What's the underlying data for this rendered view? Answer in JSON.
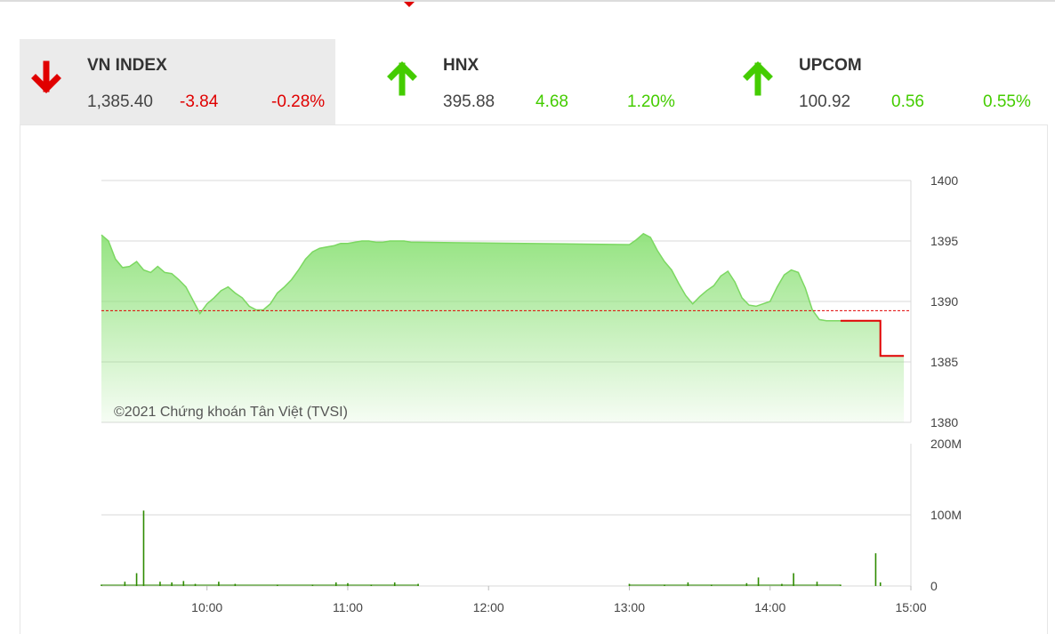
{
  "indices": [
    {
      "name": "VN INDEX",
      "value": "1,385.40",
      "change": "-3.84",
      "percent": "-0.28%",
      "direction": "down",
      "active": true
    },
    {
      "name": "HNX",
      "value": "395.88",
      "change": "4.68",
      "percent": "1.20%",
      "direction": "up",
      "active": false
    },
    {
      "name": "UPCOM",
      "value": "100.92",
      "change": "0.56",
      "percent": "0.55%",
      "direction": "up",
      "active": false
    }
  ],
  "colors": {
    "up": "#44cc00",
    "down": "#e00000",
    "area": "#8fe27a",
    "volume": "#2e8b00",
    "reference": "#e00000"
  },
  "chart_data": [
    {
      "type": "area",
      "title": "",
      "watermark": "©2021 Chứng khoán Tân Việt (TVSI)",
      "y_ticks": [
        "1400",
        "1395",
        "1390",
        "1385",
        "1380"
      ],
      "ylim": [
        1380,
        1400
      ],
      "x_ticks": [
        "10:00",
        "11:00",
        "12:00",
        "13:00",
        "14:00",
        "15:00"
      ],
      "reference": 1389.24,
      "grid": true,
      "series": [
        {
          "x": [
            "09:15",
            "09:18",
            "09:21",
            "09:24",
            "09:27",
            "09:30",
            "09:33",
            "09:36",
            "09:39",
            "09:42",
            "09:45",
            "09:48",
            "09:51",
            "09:54",
            "09:57",
            "10:00",
            "10:03",
            "10:06",
            "10:09",
            "10:12",
            "10:15",
            "10:18",
            "10:21",
            "10:24",
            "10:27",
            "10:30",
            "10:33",
            "10:36",
            "10:39",
            "10:42",
            "10:45",
            "10:48",
            "10:51",
            "10:54",
            "10:57",
            "11:00",
            "11:03",
            "11:06",
            "11:09",
            "11:12",
            "11:15",
            "11:18",
            "11:21",
            "11:24",
            "11:27",
            "11:30",
            "13:00",
            "13:03",
            "13:06",
            "13:09",
            "13:12",
            "13:15",
            "13:18",
            "13:21",
            "13:24",
            "13:27",
            "13:30",
            "13:33",
            "13:36",
            "13:39",
            "13:42",
            "13:45",
            "13:48",
            "13:51",
            "13:54",
            "13:57",
            "14:00",
            "14:03",
            "14:06",
            "14:09",
            "14:12",
            "14:15",
            "14:18",
            "14:21",
            "14:24",
            "14:27",
            "14:30"
          ],
          "y": [
            1395.5,
            1395.0,
            1393.5,
            1392.8,
            1392.9,
            1393.3,
            1392.6,
            1392.4,
            1392.9,
            1392.4,
            1392.3,
            1391.8,
            1391.2,
            1390.1,
            1389.0,
            1389.8,
            1390.3,
            1390.9,
            1391.2,
            1390.7,
            1390.3,
            1389.6,
            1389.3,
            1389.3,
            1389.8,
            1390.7,
            1391.2,
            1391.8,
            1392.6,
            1393.5,
            1394.1,
            1394.4,
            1394.5,
            1394.6,
            1394.8,
            1394.8,
            1394.9,
            1395.0,
            1395.0,
            1394.9,
            1394.9,
            1395.0,
            1395.0,
            1395.0,
            1394.9,
            1394.9,
            1394.7,
            1395.1,
            1395.6,
            1395.3,
            1394.2,
            1393.3,
            1392.6,
            1391.5,
            1390.5,
            1389.8,
            1390.4,
            1390.9,
            1391.3,
            1392.1,
            1392.5,
            1391.6,
            1390.3,
            1389.7,
            1389.6,
            1389.8,
            1390.0,
            1391.2,
            1392.2,
            1392.6,
            1392.4,
            1391.1,
            1389.3,
            1388.5,
            1388.4,
            1388.4,
            1388.4
          ]
        },
        {
          "x": [
            "14:30",
            "14:47",
            "14:47",
            "14:57"
          ],
          "y": [
            1388.4,
            1388.4,
            1385.5,
            1385.5
          ]
        }
      ]
    },
    {
      "type": "bar",
      "title": "",
      "y_ticks": [
        "200M",
        "100M",
        "0"
      ],
      "ylim": [
        0,
        200000000
      ],
      "x_ticks": [
        "10:00",
        "11:00",
        "12:00",
        "13:00",
        "14:00",
        "15:00"
      ],
      "grid": true,
      "series": [
        {
          "x": [
            "09:15",
            "09:25",
            "09:30",
            "09:33",
            "09:40",
            "09:45",
            "09:50",
            "09:55",
            "10:05",
            "10:12",
            "10:30",
            "10:45",
            "10:55",
            "11:00",
            "11:10",
            "11:20",
            "11:30",
            "13:00",
            "13:15",
            "13:25",
            "13:35",
            "13:50",
            "13:55",
            "14:05",
            "14:10",
            "14:20",
            "14:30",
            "14:45",
            "14:47"
          ],
          "values": [
            2000000,
            6000000,
            18000000,
            106000000,
            6000000,
            5000000,
            7000000,
            3000000,
            6000000,
            3000000,
            2000000,
            2000000,
            5000000,
            4000000,
            2000000,
            5000000,
            3000000,
            3000000,
            2000000,
            5000000,
            2000000,
            4000000,
            12000000,
            3000000,
            18000000,
            6000000,
            2000000,
            46000000,
            5000000
          ]
        }
      ]
    }
  ]
}
